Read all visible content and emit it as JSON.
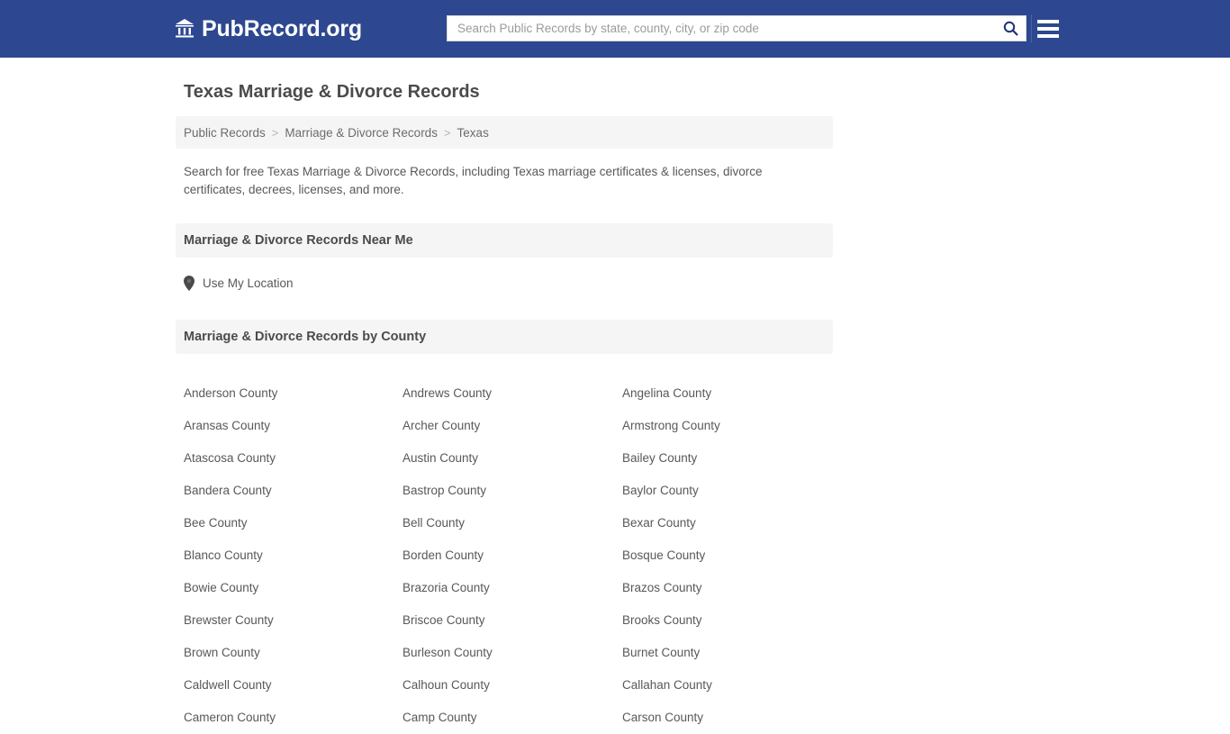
{
  "header": {
    "brand_name": "PubRecord.org",
    "brand_icon": "bank-building-icon",
    "search": {
      "placeholder": "Search Public Records by state, county, city, or zip code",
      "value": "",
      "icon": "search-icon"
    },
    "menu_icon": "hamburger-menu-icon",
    "background_color": "#2d4890"
  },
  "page": {
    "title": "Texas Marriage & Divorce Records",
    "description": "Search for free Texas Marriage & Divorce Records, including Texas marriage certificates & licenses, divorce certificates, decrees, licenses, and more."
  },
  "breadcrumb": {
    "items": [
      {
        "label": "Public Records"
      },
      {
        "label": "Marriage & Divorce Records"
      },
      {
        "label": "Texas"
      }
    ],
    "separator": ">"
  },
  "near_me": {
    "heading": "Marriage & Divorce Records Near Me",
    "link_label": "Use My Location",
    "icon": "map-pin-icon"
  },
  "by_county": {
    "heading": "Marriage & Divorce Records by County",
    "counties": [
      "Anderson County",
      "Andrews County",
      "Angelina County",
      "Aransas County",
      "Archer County",
      "Armstrong County",
      "Atascosa County",
      "Austin County",
      "Bailey County",
      "Bandera County",
      "Bastrop County",
      "Baylor County",
      "Bee County",
      "Bell County",
      "Bexar County",
      "Blanco County",
      "Borden County",
      "Bosque County",
      "Bowie County",
      "Brazoria County",
      "Brazos County",
      "Brewster County",
      "Briscoe County",
      "Brooks County",
      "Brown County",
      "Burleson County",
      "Burnet County",
      "Caldwell County",
      "Calhoun County",
      "Callahan County",
      "Cameron County",
      "Camp County",
      "Carson County"
    ]
  },
  "colors": {
    "header_blue": "#2d4890",
    "panel_gray": "#f5f5f5",
    "body_text": "#585858",
    "heading_text": "#4b4b4b"
  }
}
